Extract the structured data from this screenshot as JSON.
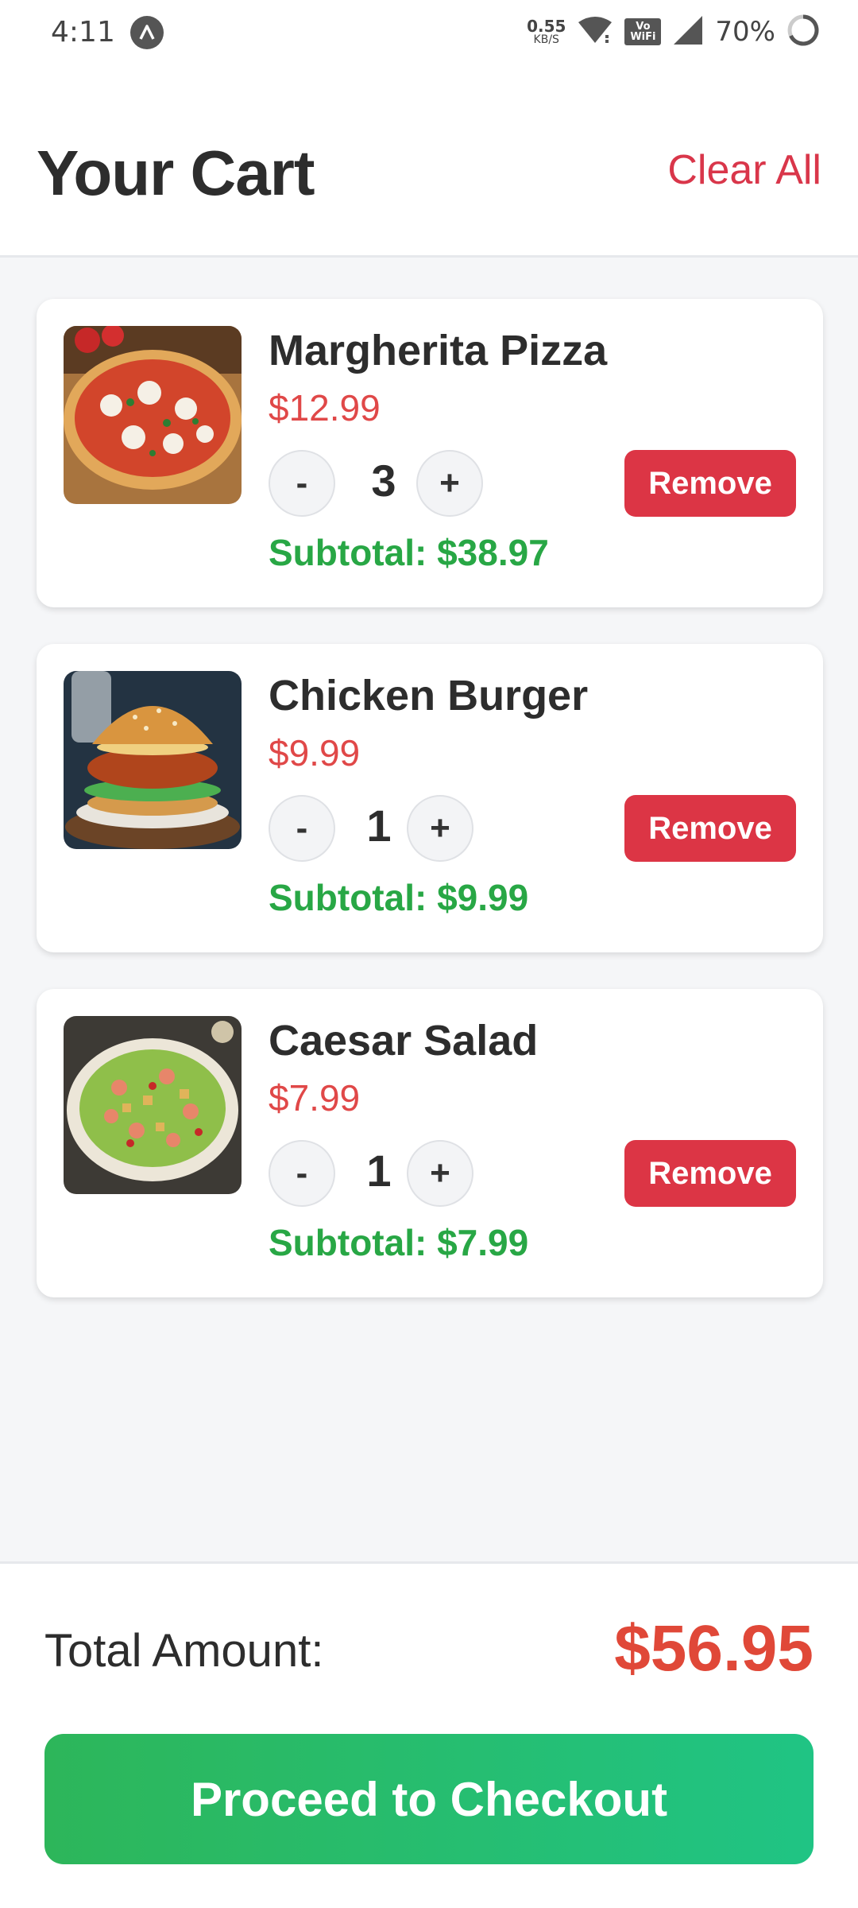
{
  "status_bar": {
    "time": "4:11",
    "net_speed_value": "0.55",
    "net_speed_unit": "KB/S",
    "vowifi_top": "Vo",
    "vowifi_bottom": "WiFi",
    "battery": "70%",
    "icons": [
      "app-notification-icon",
      "wifi-icon",
      "vowifi-icon",
      "signal-icon",
      "battery-icon"
    ]
  },
  "header": {
    "title": "Your Cart",
    "clear_all": "Clear All"
  },
  "cart": {
    "items": [
      {
        "name": "Margherita Pizza",
        "price": "$12.99",
        "quantity": "3",
        "subtotal": "Subtotal: $38.97",
        "remove": "Remove",
        "minus": "-",
        "plus": "+"
      },
      {
        "name": "Chicken Burger",
        "price": "$9.99",
        "quantity": "1",
        "subtotal": "Subtotal: $9.99",
        "remove": "Remove",
        "minus": "-",
        "plus": "+"
      },
      {
        "name": "Caesar Salad",
        "price": "$7.99",
        "quantity": "1",
        "subtotal": "Subtotal: $7.99",
        "remove": "Remove",
        "minus": "-",
        "plus": "+"
      }
    ]
  },
  "footer": {
    "total_label": "Total Amount:",
    "total_value": "$56.95",
    "checkout": "Proceed to Checkout"
  },
  "colors": {
    "accent_red": "#dc3545",
    "price_red": "#e04848",
    "subtotal_green": "#28a745",
    "checkout_green": "#2db65a"
  }
}
